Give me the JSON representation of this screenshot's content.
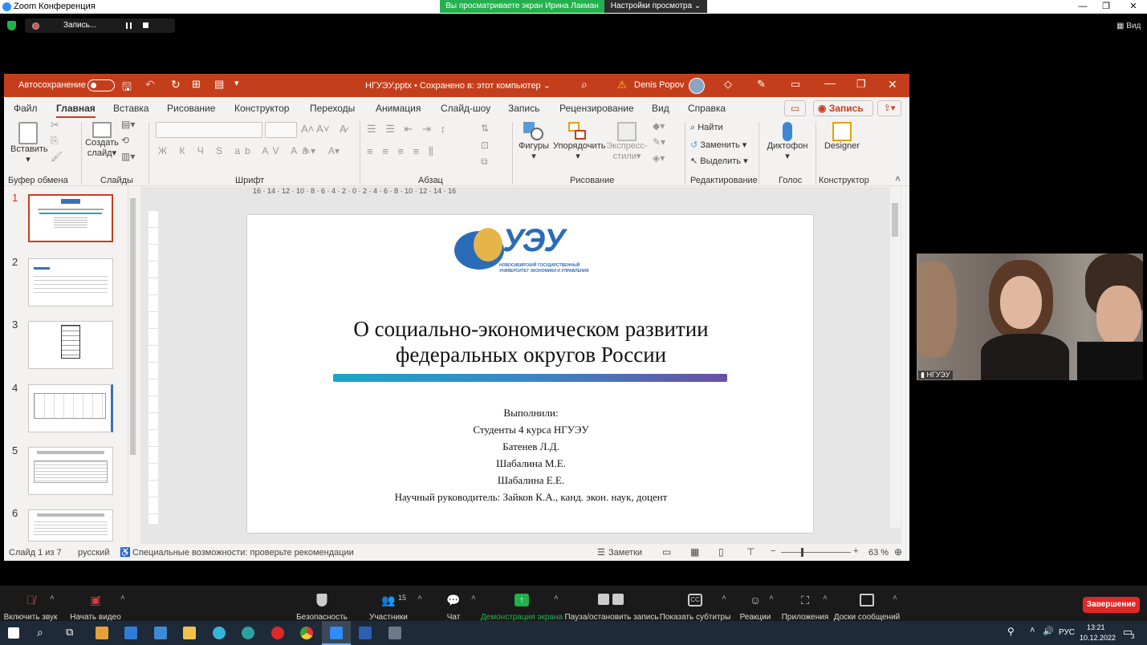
{
  "zoom": {
    "window_title": "Zoom Конференция",
    "share_banner": "Вы просматриваете экран Ирина Лакман",
    "view_options": "Настройки просмотра ⌄",
    "recording_label": "Запись...",
    "view_label": "Вид",
    "participant_name": "НГУЭУ",
    "toolbar": {
      "mute": "Включить звук",
      "video": "Начать видео",
      "security": "Безопасность",
      "participants": "Участники",
      "participants_count": "15",
      "chat": "Чат",
      "share": "Демонстрация экрана",
      "record": "Пауза/остановить запись",
      "captions": "Показать субтитры",
      "reactions": "Реакции",
      "apps": "Приложения",
      "whiteboard": "Доски сообщений",
      "end": "Завершение"
    }
  },
  "ppt": {
    "autosave_label": "Автосохранение",
    "autosave_state": "Откл",
    "doc_title": "НГУЭУ.pptx • Сохранено в: этот компьютер ⌄",
    "user_name": "Denis Popov",
    "tabs": [
      "Файл",
      "Главная",
      "Вставка",
      "Рисование",
      "Конструктор",
      "Переходы",
      "Анимация",
      "Слайд-шоу",
      "Запись",
      "Рецензирование",
      "Вид",
      "Справка"
    ],
    "record_button": "Запись",
    "ribbon": {
      "paste": "Вставить",
      "new_slide_1": "Создать",
      "new_slide_2": "слайд",
      "shapes": "Фигуры",
      "arrange": "Упорядочить",
      "quick_styles_1": "Экспресс-",
      "quick_styles_2": "стили",
      "find": "Найти",
      "replace": "Заменить",
      "select": "Выделить",
      "dictate": "Диктофон",
      "designer": "Designer",
      "groups": [
        "Буфер обмена",
        "Слайды",
        "Шрифт",
        "Абзац",
        "Рисование",
        "Редактирование",
        "Голос",
        "Конструктор"
      ]
    },
    "thumb_numbers": [
      "1",
      "2",
      "3",
      "4",
      "5",
      "6"
    ],
    "ruler_h": "16 · 14 · 12 · 10 · 8 · 6 · 4 · 2 · 0 · 2 · 4 · 6 · 8 · 10 · 12 · 14 · 16",
    "slide": {
      "logo_letters": "УЭУ",
      "logo_line1": "НОВОСИБИРСКИЙ ГОСУДАРСТВЕННЫЙ",
      "logo_line2": "УНИВЕРСИТЕТ ЭКОНОМИКИ И УПРАВЛЕНИЯ",
      "title_line1": "О социально-экономическом развитии",
      "title_line2": "федеральных округов России",
      "authors": [
        "Выполнили:",
        "Студенты 4 курса НГУЭУ",
        "Батенев Л.Д.",
        "Шабалина М.Е.",
        "Шабалина Е.Е.",
        "Научный руководитель: Зайков К.А., канд. экон. наук, доцент"
      ]
    },
    "status": {
      "slide_of": "Слайд 1 из 7",
      "language": "русский",
      "accessibility": "Специальные возможности: проверьте рекомендации",
      "notes": "Заметки",
      "zoom": "63 %"
    }
  },
  "taskbar": {
    "lang": "РУС",
    "time": "13:21",
    "date": "10.12.2022",
    "notif_count": "3"
  },
  "colors": {
    "ppt_accent": "#c43e1c",
    "zoom_green": "#23b14d",
    "end_red": "#e02828",
    "slide_bar_start": "#1aa6c8",
    "slide_bar_end": "#6a4fa3"
  }
}
